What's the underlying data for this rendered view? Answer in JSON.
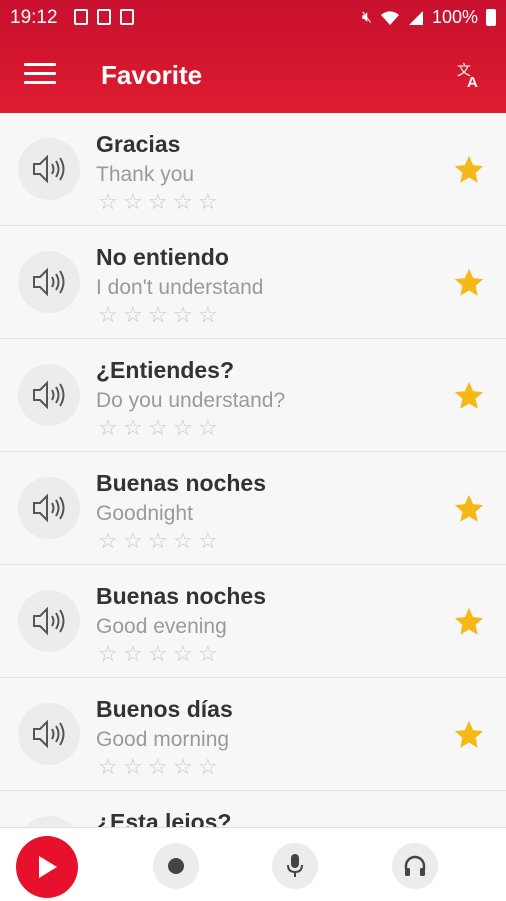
{
  "status_bar": {
    "time": "19:12",
    "battery": "100%"
  },
  "app_bar": {
    "title": "Favorite",
    "menu_icon": "menu-icon",
    "translate_icon": "translate-icon"
  },
  "colors": {
    "primary": "#d4132d",
    "star_favorite": "#f6b817",
    "star_empty": "#c8c8c8"
  },
  "phrases": [
    {
      "phrase": "Gracias",
      "translation": "Thank you",
      "rating": 0,
      "favorite": true
    },
    {
      "phrase": "No entiendo",
      "translation": "I don't understand",
      "rating": 0,
      "favorite": true
    },
    {
      "phrase": "¿Entiendes?",
      "translation": "Do you understand?",
      "rating": 0,
      "favorite": true
    },
    {
      "phrase": "Buenas noches",
      "translation": "Goodnight",
      "rating": 0,
      "favorite": true
    },
    {
      "phrase": "Buenas noches",
      "translation": "Good evening",
      "rating": 0,
      "favorite": true
    },
    {
      "phrase": "Buenos días",
      "translation": "Good morning",
      "rating": 0,
      "favorite": true
    },
    {
      "phrase": "¿Esta lejos?",
      "translation": "",
      "rating": 0,
      "favorite": true
    }
  ],
  "bottom_bar": {
    "play_icon": "play-icon",
    "record_icon": "record-icon",
    "mic_icon": "microphone-icon",
    "headphones_icon": "headphones-icon"
  }
}
